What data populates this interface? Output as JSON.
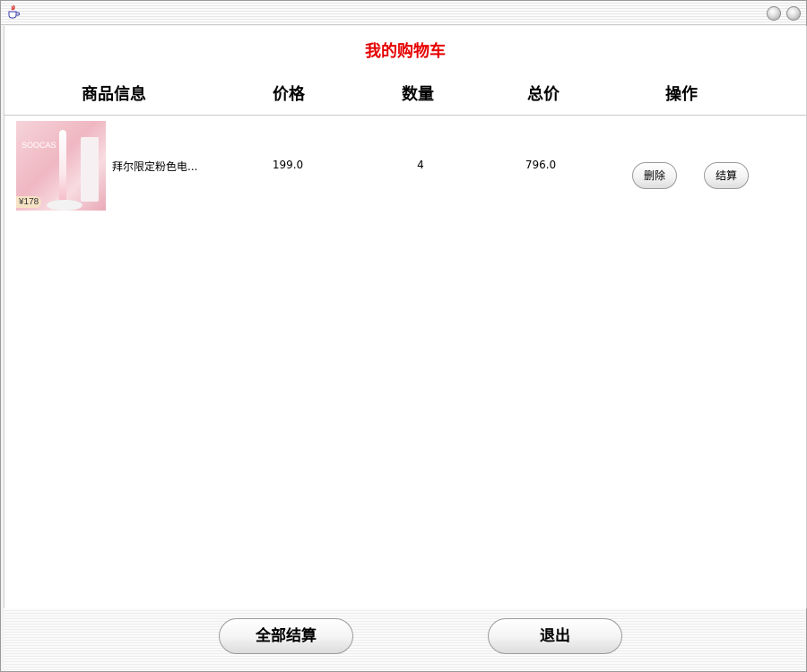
{
  "window": {
    "icons": {
      "app": "java-cup-icon",
      "minimize": "minimize-icon",
      "close": "close-icon"
    }
  },
  "cart": {
    "title": "我的购物车",
    "title_color": "#e60000",
    "columns": [
      "商品信息",
      "价格",
      "数量",
      "总价",
      "操作"
    ],
    "items": [
      {
        "name": "拜尔限定粉色电...",
        "price": "199.0",
        "quantity": "4",
        "total": "796.0",
        "thumb_brand": "SOOCAS",
        "thumb_price": "¥178",
        "delete_label": "删除",
        "settle_label": "结算"
      }
    ]
  },
  "footer": {
    "settle_all_label": "全部结算",
    "exit_label": "退出"
  }
}
